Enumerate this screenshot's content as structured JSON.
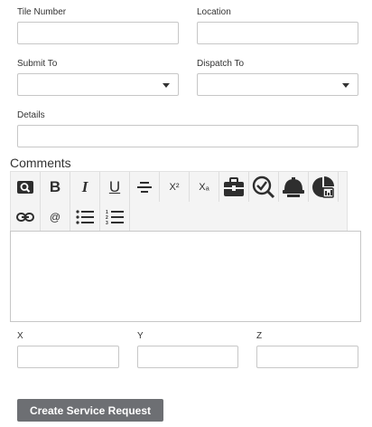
{
  "form": {
    "tile_number_label": "Tile Number",
    "location_label": "Location",
    "submit_to_label": "Submit To",
    "dispatch_to_label": "Dispatch To",
    "details_label": "Details",
    "tile_number_value": "",
    "location_value": "",
    "submit_to_value": "",
    "dispatch_to_value": "",
    "details_value": ""
  },
  "comments": {
    "title": "Comments",
    "toolbar": {
      "row1": [
        "search-icon",
        "bold-icon",
        "italic-icon",
        "underline-icon",
        "strikethrough-icon",
        "superscript-icon",
        "subscript-icon",
        "toolbox-icon",
        "inspect-icon",
        "hardhat-icon",
        "chart-icon"
      ],
      "row2": [
        "link-icon",
        "mention-icon",
        "bulleted-list-icon",
        "numbered-list-icon"
      ],
      "bold_glyph": "B",
      "italic_glyph": "I",
      "underline_glyph": "U",
      "superscript_glyph": "X²",
      "subscript_glyph": "Xₐ",
      "mention_glyph": "@"
    },
    "body": ""
  },
  "coordinates": {
    "x_label": "X",
    "y_label": "Y",
    "z_label": "Z",
    "x_value": "",
    "y_value": "",
    "z_value": ""
  },
  "actions": {
    "create_label": "Create Service Request"
  }
}
